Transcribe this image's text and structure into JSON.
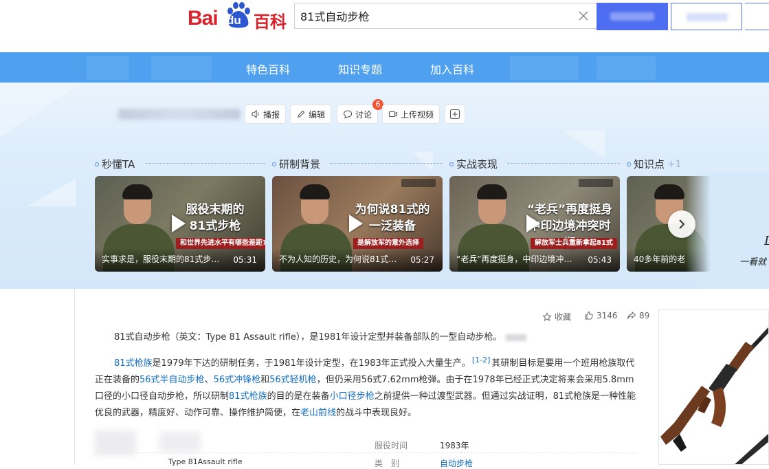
{
  "logo": {
    "bai": "Bai",
    "du": "du",
    "baike": "百科"
  },
  "search": {
    "query": "81式自动步枪"
  },
  "nav": {
    "items": [
      "特色百科",
      "知识专题",
      "加入百科"
    ]
  },
  "toolbar": {
    "broadcast": "播报",
    "edit": "编辑",
    "discuss": "讨论",
    "discuss_badge": "6",
    "upload_video": "上传视频"
  },
  "sections": [
    {
      "label": "秒懂TA"
    },
    {
      "label": "研制背景"
    },
    {
      "label": "实战表现"
    },
    {
      "label": "知识点",
      "extra": "+1"
    }
  ],
  "videos": [
    {
      "title1": "服役末期的",
      "title2": "81式步枪",
      "subtitle": "和世界先进水平有哪些差距?",
      "caption": "实事求是，服役末期的81式步枪...",
      "duration": "05:31"
    },
    {
      "title1": "为何说81式的",
      "title2": "一泛装备",
      "subtitle": "是解放军的意外选择",
      "caption": "不为人知的历史，为何说81式的...",
      "duration": "05:27"
    },
    {
      "title1": "“老兵”再度挺身",
      "title2": "中印边境冲突时期",
      "subtitle": "解放军士兵重新拿起81式",
      "caption": "“老兵”再度挺身，中印边境冲突...",
      "duration": "05:43"
    },
    {
      "title1": "",
      "title2": "",
      "subtitle": "",
      "caption": "40多年前的老",
      "duration": ""
    }
  ],
  "signature": {
    "line1": "一看就",
    "line2": "L"
  },
  "actions": {
    "favorite": "收藏",
    "likes": "3146",
    "shares": "89"
  },
  "article": {
    "summary": "81式自动步枪（英文：Type 81 Assault rifle），是1981年设计定型并装备部队的一型自动步枪。",
    "p1_link1": "81式枪族",
    "p1_t1": "是1979年下达的研制任务，于1981年设计定型，在1983年正式投入大量生产。",
    "p1_ref": "[1-2]",
    "p1_t2": "其研制目标是要用一个班用枪族取代正在装备的",
    "p1_link2": "56式半自动步枪",
    "p1_t3": "、",
    "p1_link3": "56式冲锋枪",
    "p1_t4": "和",
    "p1_link4": "56式轻机枪",
    "p1_t5": "，但仍采用56式7.62mm枪弹。由于在1978年已经正式决定将来会采用5.8mm口径的小口径自动步枪，所以研制",
    "p1_link5": "81式枪族",
    "p1_t6": "的目的是在装备",
    "p1_link6": "小口径步枪",
    "p1_t7": "之前提供一种过渡型武器。但通过实战证明，81式枪族是一种性能优良的武器，精度好、动作可靠、操作维护简便，在",
    "p1_link7": "老山前线",
    "p1_t8": "的战斗中表现良好。"
  },
  "infobox": {
    "service_key": "服役时间",
    "service_val": "1983年",
    "type_key": "类　别",
    "type_val": "自动步枪",
    "english_val": "Type 81Assault rifle"
  },
  "colors": {
    "nav": "#4fa1f0",
    "link": "#136ec2",
    "brand_red": "#d9222a",
    "brand_blue": "#2c57d1"
  }
}
